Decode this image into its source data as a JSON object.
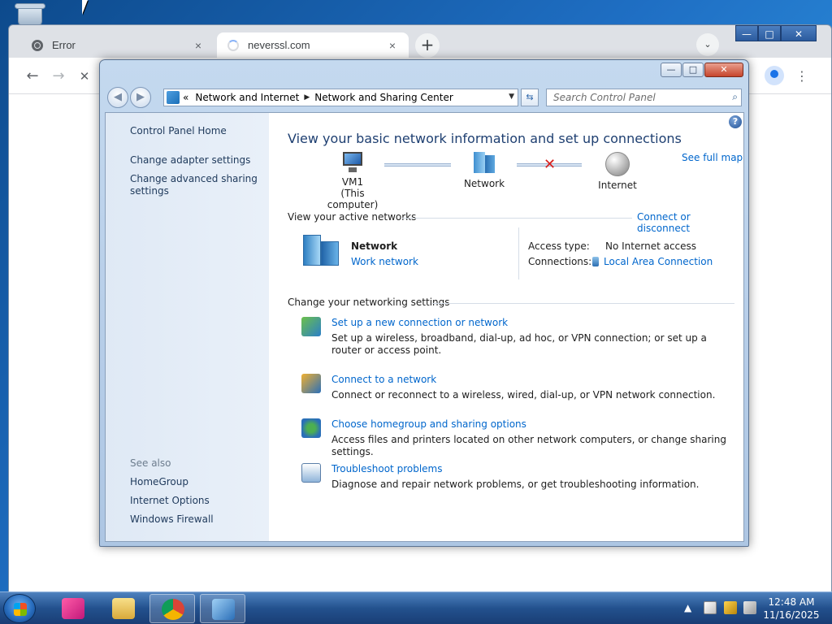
{
  "browser": {
    "tabs": [
      {
        "label": "Error",
        "close": "×"
      },
      {
        "label": "neverssl.com",
        "close": "×"
      }
    ],
    "new_tab": "+",
    "tab_search": "⌄",
    "window_controls": {
      "minimize": "—",
      "maximize": "□",
      "close": "✕"
    },
    "nav": {
      "back": "←",
      "forward": "→",
      "stop": "✕"
    },
    "menu": "⋮"
  },
  "control_panel": {
    "window_controls": {
      "minimize": "—",
      "maximize": "□",
      "close": "✕"
    },
    "nav": {
      "back": "◀",
      "forward": "▶"
    },
    "address": {
      "prefix": "«",
      "crumb1": "Network and Internet",
      "crumb2": "Network and Sharing Center",
      "separator": "▶",
      "dropdown": "▼"
    },
    "refresh": "⇆",
    "search_placeholder": "Search Control Panel",
    "search_icon": "⌕",
    "sidebar": {
      "home": "Control Panel Home",
      "links": [
        "Change adapter settings",
        "Change advanced sharing settings"
      ],
      "see_also_label": "See also",
      "see_also": [
        "HomeGroup",
        "Internet Options",
        "Windows Firewall"
      ]
    },
    "main": {
      "help": "?",
      "title": "View your basic network information and set up connections",
      "see_full_map": "See full map",
      "map": {
        "computer": "VM1",
        "computer_sub": "(This computer)",
        "network": "Network",
        "internet": "Internet",
        "broken": "✕"
      },
      "active_networks_label": "View your active networks",
      "connect_disconnect": "Connect or disconnect",
      "active_network": {
        "name": "Network",
        "type": "Work network",
        "access_type_label": "Access type:",
        "access_type_value": "No Internet access",
        "connections_label": "Connections:",
        "connections_value": "Local Area Connection"
      },
      "change_settings_label": "Change your networking settings",
      "tasks": [
        {
          "title": "Set up a new connection or network",
          "desc": "Set up a wireless, broadband, dial-up, ad hoc, or VPN connection; or set up a router or access point.",
          "icon": "new-connection-icon"
        },
        {
          "title": "Connect to a network",
          "desc": "Connect or reconnect to a wireless, wired, dial-up, or VPN network connection.",
          "icon": "connect-network-icon"
        },
        {
          "title": "Choose homegroup and sharing options",
          "desc": "Access files and printers located on other network computers, or change sharing settings.",
          "icon": "homegroup-icon"
        },
        {
          "title": "Troubleshoot problems",
          "desc": "Diagnose and repair network problems, or get troubleshooting information.",
          "icon": "troubleshoot-icon"
        }
      ]
    }
  },
  "taskbar": {
    "tray_arrow": "▲",
    "time": "12:48 AM",
    "date": "11/16/2025"
  }
}
